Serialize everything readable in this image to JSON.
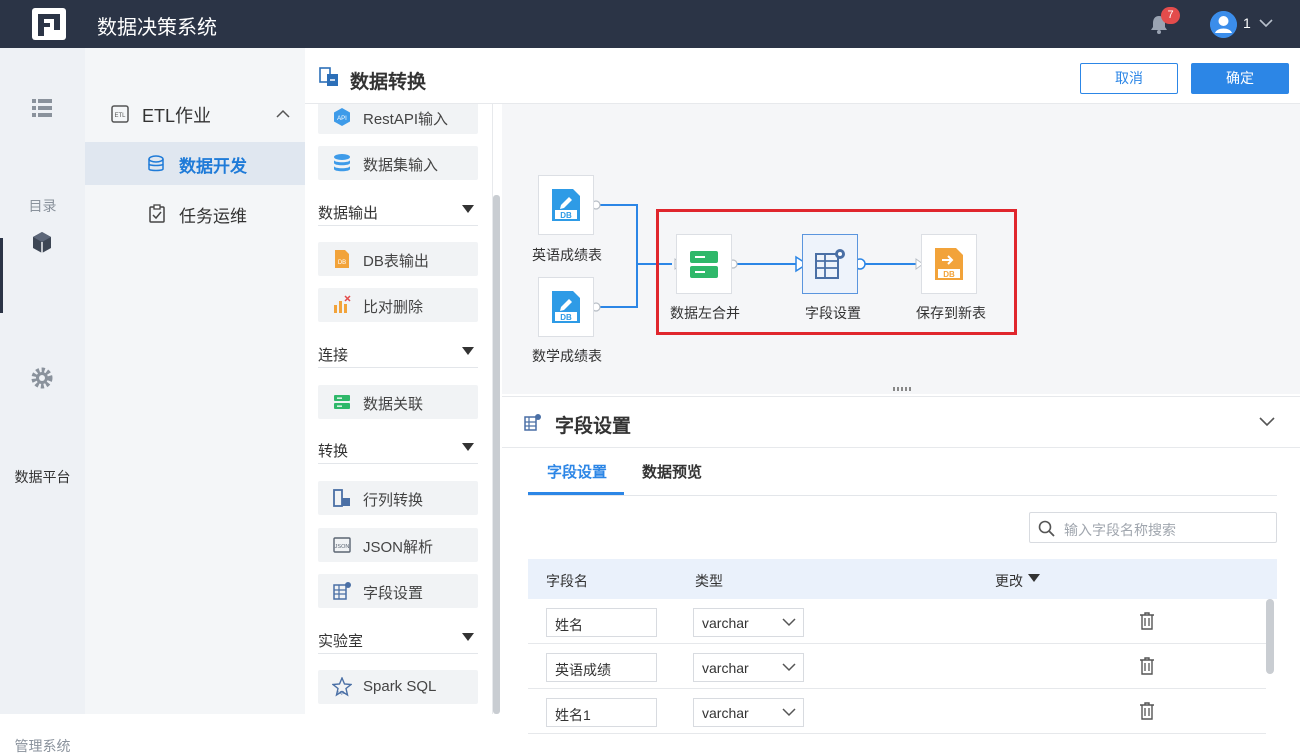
{
  "app": {
    "title": "数据决策系统",
    "notification_count": "7",
    "user_name": "1"
  },
  "leftnav": [
    {
      "label": "目录",
      "icon": "list-icon"
    },
    {
      "label": "数据平台",
      "icon": "cube-icon"
    },
    {
      "label": "管理系统",
      "icon": "gear-icon"
    }
  ],
  "subnav": {
    "group_label": "ETL作业",
    "items": [
      {
        "label": "数据开发",
        "icon": "database-icon"
      },
      {
        "label": "任务运维",
        "icon": "clipboard-icon"
      }
    ]
  },
  "header": {
    "title": "数据转换",
    "cancel_label": "取消",
    "ok_label": "确定"
  },
  "toolbox": {
    "top_tools": [
      "RestAPI输入",
      "数据集输入"
    ],
    "sections": [
      {
        "label": "数据输出",
        "tools": [
          "DB表输出",
          "比对删除"
        ]
      },
      {
        "label": "连接",
        "tools": [
          "数据关联"
        ]
      },
      {
        "label": "转换",
        "tools": [
          "行列转换",
          "JSON解析",
          "字段设置"
        ]
      },
      {
        "label": "实验室",
        "tools": [
          "Spark SQL"
        ]
      }
    ]
  },
  "canvas": {
    "nodes": [
      {
        "label": "英语成绩表",
        "icon": "db-input-icon"
      },
      {
        "label": "数学成绩表",
        "icon": "db-input-icon"
      },
      {
        "label": "数据左合并",
        "icon": "merge-icon"
      },
      {
        "label": "字段设置",
        "icon": "field-settings-icon"
      },
      {
        "label": "保存到新表",
        "icon": "db-output-icon"
      }
    ],
    "highlight_color": "#e0262d"
  },
  "panel": {
    "title": "字段设置",
    "tabs": [
      "字段设置",
      "数据预览"
    ],
    "search_placeholder": "输入字段名称搜索",
    "columns": [
      "字段名",
      "类型",
      "更改"
    ],
    "rows": [
      {
        "name": "姓名",
        "type": "varchar"
      },
      {
        "name": "英语成绩",
        "type": "varchar"
      },
      {
        "name": "姓名1",
        "type": "varchar"
      }
    ]
  },
  "colors": {
    "accent": "#2c86e6",
    "topbar": "#2b3446"
  }
}
